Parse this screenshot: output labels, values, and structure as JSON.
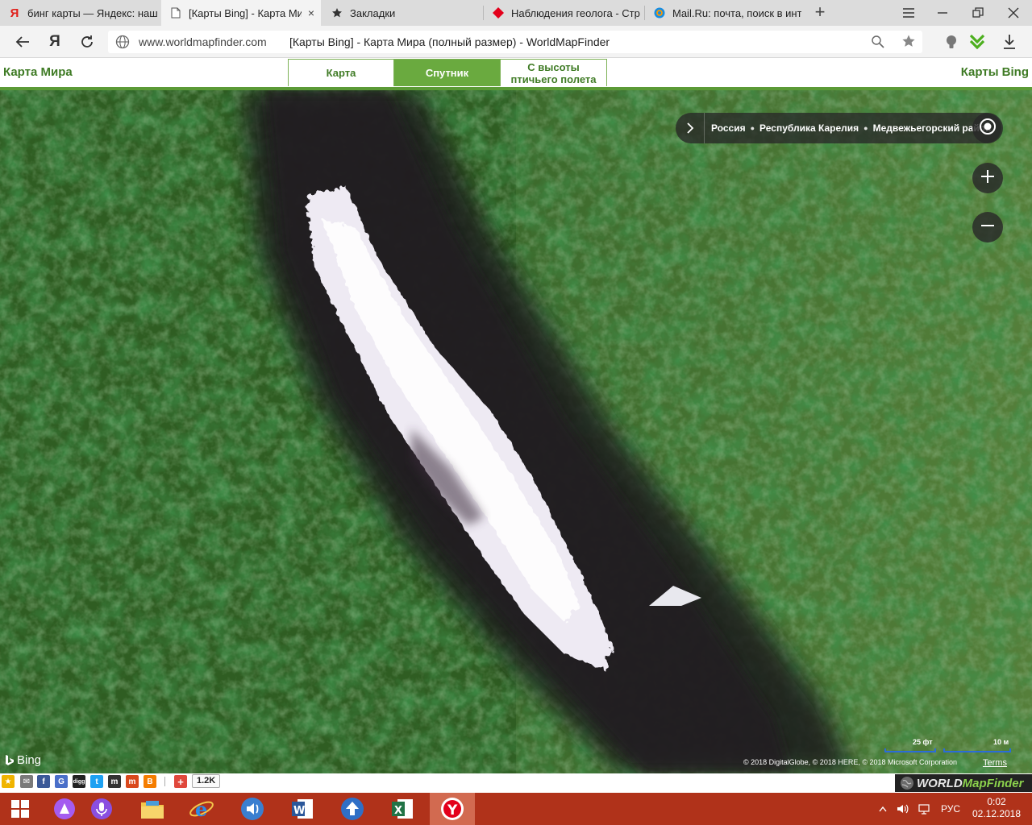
{
  "browser": {
    "tabs": [
      {
        "title": "бинг карты — Яндекс: наш",
        "favicon": "yandex-icon"
      },
      {
        "title": "[Карты Bing] - Карта Ми",
        "favicon": "page-icon",
        "active": true
      },
      {
        "title": "Закладки",
        "favicon": "star-icon"
      },
      {
        "title": "Наблюдения геолога - Стр",
        "favicon": "red-diamond-icon"
      },
      {
        "title": "Mail.Ru: почта, поиск в инт",
        "favicon": "mailru-icon"
      }
    ],
    "close_glyph": "×",
    "new_tab_glyph": "+",
    "address": {
      "host": "www.worldmapfinder.com",
      "title": "[Карты Bing] - Карта Мира (полный размер) - WorldMapFinder"
    },
    "yandex_logo": "Я"
  },
  "site": {
    "title_left": "Карта Мира",
    "title_right": "Карты Bing",
    "modes": [
      {
        "label": "Карта",
        "active": false
      },
      {
        "label": "Спутник",
        "active": true
      },
      {
        "label": "С высоты\nптичьего полета",
        "active": false
      }
    ]
  },
  "map": {
    "breadcrumb": [
      "Россия",
      "Республика Карелия",
      "Медвежьегорский район"
    ],
    "bing_label": "Bing",
    "copyright": "© 2018 DigitalGlobe, © 2018 HERE, © 2018 Microsoft Corporation",
    "terms": "Terms",
    "scale_ft": "25 фт",
    "scale_m": "10 м"
  },
  "share": {
    "icons": [
      {
        "name": "favorite-star-icon",
        "glyph": "★",
        "color": "#f0b400"
      },
      {
        "name": "email-share-icon",
        "glyph": "✉",
        "color": "#7a7a7a"
      },
      {
        "name": "facebook-share-icon",
        "glyph": "f",
        "color": "#3b5998"
      },
      {
        "name": "google-share-icon",
        "glyph": "G",
        "color": "#4a6fc9"
      },
      {
        "name": "digg-share-icon",
        "glyph": "digg",
        "color": "#222222"
      },
      {
        "name": "twitter-share-icon",
        "glyph": "t",
        "color": "#1da1f2"
      },
      {
        "name": "myspace-share-icon",
        "glyph": "m",
        "color": "#333333"
      },
      {
        "name": "mixx-share-icon",
        "glyph": "m",
        "color": "#d9481c"
      },
      {
        "name": "blogger-share-icon",
        "glyph": "B",
        "color": "#f57d00"
      },
      {
        "name": "addthis-plus-icon",
        "glyph": "+",
        "color": "#e0483c"
      }
    ],
    "count": "1.2K",
    "logo_a": "WORLD",
    "logo_b": "MapFinder"
  },
  "taskbar": {
    "language": "РУС",
    "time": "0:02",
    "date": "02.12.2018"
  },
  "colors": {
    "site_green": "#3f7b25",
    "mode_active": "#6aaa3f",
    "taskbar": "#b0321a"
  }
}
